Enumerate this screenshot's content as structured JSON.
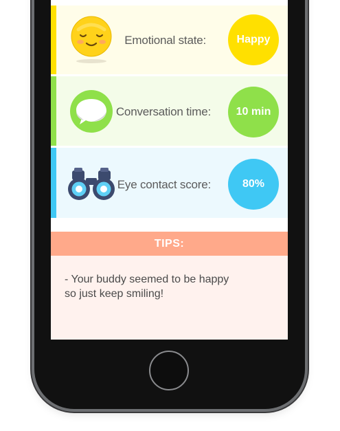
{
  "metrics": [
    {
      "key": "emotional",
      "label": "Emotional state:",
      "value": "Happy",
      "icon": "smiley-face-icon",
      "stripe_color": "#ffe000",
      "row_bg": "#fffde9",
      "badge_color": "#ffe000"
    },
    {
      "key": "conversation",
      "label": "Conversation time:",
      "value": "10 min",
      "icon": "speech-bubble-icon",
      "stripe_color": "#8fe04a",
      "row_bg": "#f4fce9",
      "badge_color": "#8fe04a"
    },
    {
      "key": "eye_contact",
      "label": "Eye contact score:",
      "value": "80%",
      "icon": "binoculars-icon",
      "stripe_color": "#3fc8f4",
      "row_bg": "#ecf9fe",
      "badge_color": "#3fc8f4"
    }
  ],
  "tips": {
    "header": "TIPS:",
    "header_color": "#ffa98a",
    "body_bg": "#fff2ee",
    "text": "- Your buddy seemed to be happy\nso just keep smiling!"
  }
}
